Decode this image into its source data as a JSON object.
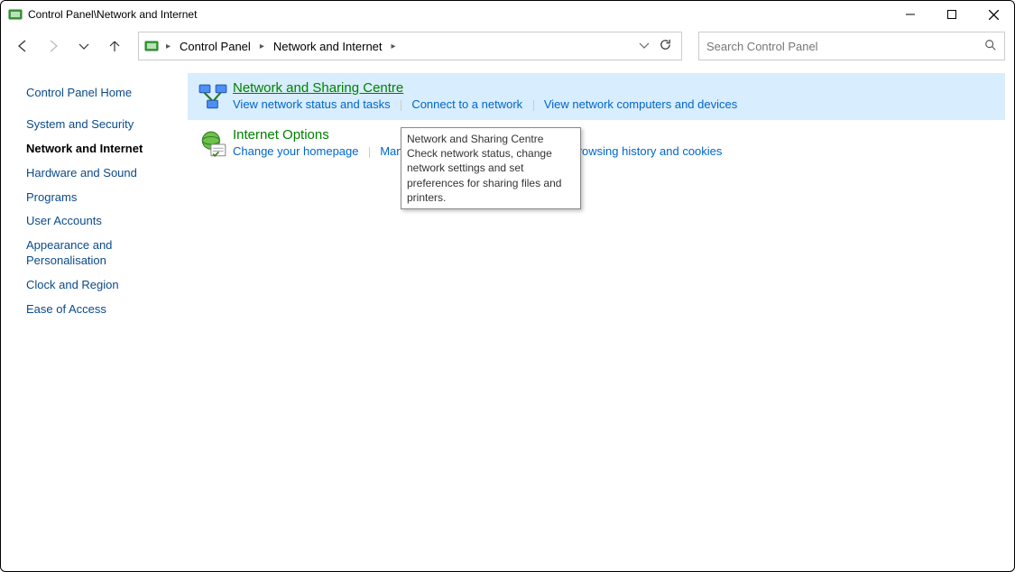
{
  "window": {
    "title": "Control Panel\\Network and Internet"
  },
  "breadcrumb": {
    "root": "Control Panel",
    "current": "Network and Internet"
  },
  "search": {
    "placeholder": "Search Control Panel"
  },
  "sidebar": {
    "home": "Control Panel Home",
    "items": [
      "System and Security",
      "Network and Internet",
      "Hardware and Sound",
      "Programs",
      "User Accounts",
      "Appearance and Personalisation",
      "Clock and Region",
      "Ease of Access"
    ]
  },
  "categories": {
    "network_sharing": {
      "title": "Network and Sharing Centre",
      "links": [
        "View network status and tasks",
        "Connect to a network",
        "View network computers and devices"
      ]
    },
    "internet_options": {
      "title": "Internet Options",
      "links": [
        "Change your homepage",
        "Manage browser add-ons",
        "Delete browsing history and cookies"
      ]
    }
  },
  "tooltip": {
    "title": "Network and Sharing Centre",
    "body": "Check network status, change network settings and set preferences for sharing files and printers."
  }
}
